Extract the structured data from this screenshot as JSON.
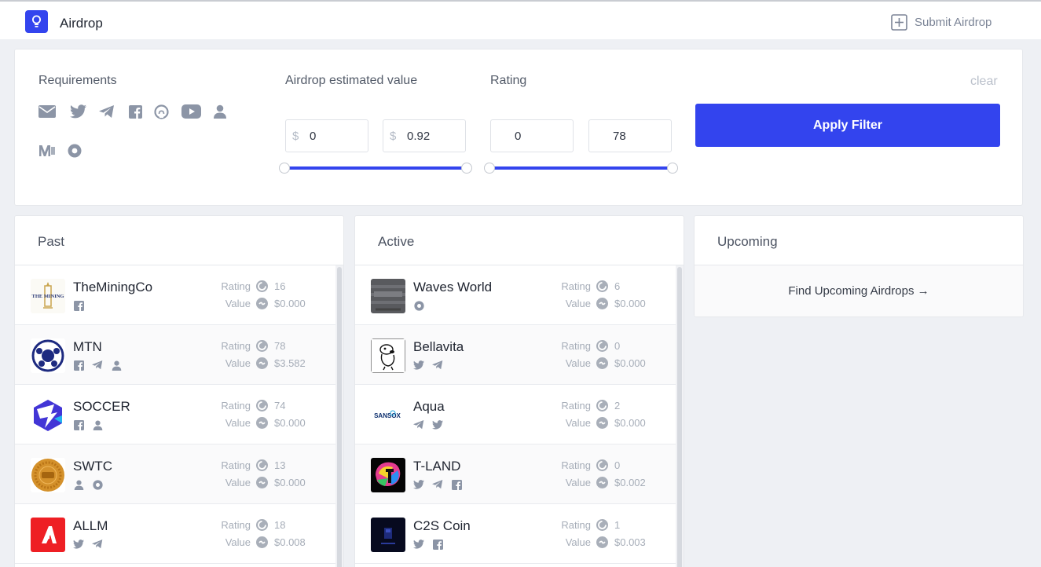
{
  "header": {
    "title": "Airdrop",
    "submit_label": "Submit Airdrop"
  },
  "filters": {
    "requirements_label": "Requirements",
    "requirement_icons": [
      "email-icon",
      "twitter-icon",
      "telegram-icon",
      "facebook-icon",
      "github-icon",
      "youtube-icon",
      "user-icon",
      "medium-icon",
      "circle-dot-icon"
    ],
    "value_label": "Airdrop estimated value",
    "value_min": "0",
    "value_max": "0.92",
    "currency": "$",
    "rating_label": "Rating",
    "rating_min": "0",
    "rating_max": "78",
    "clear_label": "clear",
    "apply_label": "Apply Filter"
  },
  "columns": {
    "past_title": "Past",
    "active_title": "Active",
    "upcoming_title": "Upcoming",
    "upcoming_link": "Find Upcoming Airdrops →",
    "rating_label": "Rating",
    "value_label": "Value"
  },
  "past": [
    {
      "name": "TheMiningCo",
      "rating": "16",
      "value": "$0.000",
      "socials": [
        "facebook-icon"
      ],
      "thumb": "mining"
    },
    {
      "name": "MTN",
      "rating": "78",
      "value": "$3.582",
      "socials": [
        "facebook-icon",
        "telegram-icon",
        "user-icon"
      ],
      "thumb": "mtn"
    },
    {
      "name": "SOCCER",
      "rating": "74",
      "value": "$0.000",
      "socials": [
        "facebook-icon",
        "user-icon"
      ],
      "thumb": "soccer"
    },
    {
      "name": "SWTC",
      "rating": "13",
      "value": "$0.000",
      "socials": [
        "user-icon",
        "circle-dot-icon"
      ],
      "thumb": "swtc"
    },
    {
      "name": "ALLM",
      "rating": "18",
      "value": "$0.008",
      "socials": [
        "twitter-icon",
        "telegram-icon"
      ],
      "thumb": "allm"
    }
  ],
  "active": [
    {
      "name": "Waves World",
      "rating": "6",
      "value": "$0.000",
      "socials": [
        "circle-dot-icon"
      ],
      "thumb": "waves"
    },
    {
      "name": "Bellavita",
      "rating": "0",
      "value": "$0.000",
      "socials": [
        "twitter-icon",
        "telegram-icon"
      ],
      "thumb": "bella"
    },
    {
      "name": "Aqua",
      "rating": "2",
      "value": "$0.000",
      "socials": [
        "telegram-icon",
        "twitter-icon"
      ],
      "thumb": "aqua"
    },
    {
      "name": "T-LAND",
      "rating": "0",
      "value": "$0.002",
      "socials": [
        "twitter-icon",
        "telegram-icon",
        "facebook-icon"
      ],
      "thumb": "tland"
    },
    {
      "name": "C2S Coin",
      "rating": "1",
      "value": "$0.003",
      "socials": [
        "twitter-icon",
        "facebook-icon"
      ],
      "thumb": "c2s"
    }
  ],
  "thumb_text": {
    "mining": "THE MINING",
    "aqua": "SANSOX"
  },
  "colors": {
    "accent": "#3344ee",
    "muted": "#a6adb8",
    "icon": "#8c95a6"
  }
}
